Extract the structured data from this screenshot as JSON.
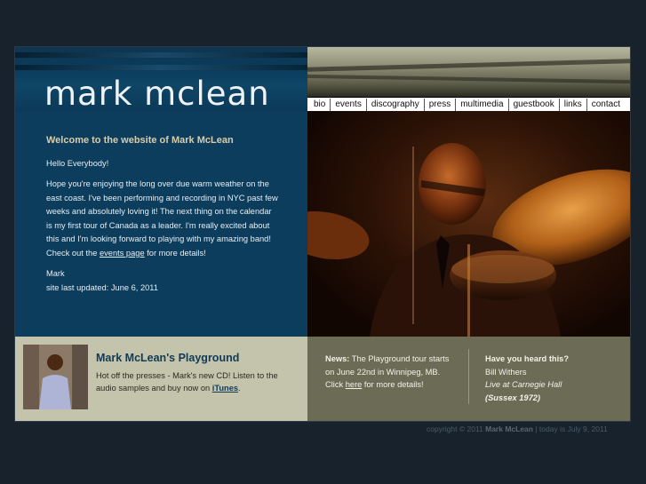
{
  "logo": "mark mclean",
  "nav": [
    "bio",
    "events",
    "discography",
    "press",
    "multimedia",
    "guestbook",
    "links",
    "contact"
  ],
  "welcome": {
    "heading": "Welcome to the website of Mark McLean",
    "greeting": "Hello Everybody!",
    "para_text": "Hope you're enjoying the long over due warm weather on the east coast.  I've been performing and recording in NYC past few weeks and absolutely loving it!  The next thing on the calendar is my first tour of Canada as a leader.  I'm really excited about this and I'm looking forward to playing with my amazing band!  Check out the ",
    "para_link": "events page",
    "para_tail": " for more details!",
    "signature": "Mark",
    "updated": "site last updated: June 6, 2011"
  },
  "promo": {
    "title": "Mark McLean's Playground",
    "body_text": "Hot off the presses - Mark's new CD! Listen to the audio samples and buy now on ",
    "body_link": "iTunes",
    "body_tail": "."
  },
  "news": {
    "label": "News:",
    "text": " The Playground tour starts on June 22nd in Winnipeg, MB.  Click ",
    "link": "here",
    "tail": " for more details!"
  },
  "heard": {
    "heading": "Have you heard this?",
    "artist": "Bill Withers",
    "album": "Live at Carnegie Hall",
    "label": "(Sussex 1972)"
  },
  "footer": {
    "copyright": "copyright © 2011 ",
    "name": "Mark McLean",
    "date": " | today is July 9, 2011"
  },
  "colors": {
    "welcome_bg": "#0d3d5c",
    "heading": "#d8ccab",
    "promo_bg": "#c3c4ab",
    "news_bg": "#6b6b56"
  }
}
